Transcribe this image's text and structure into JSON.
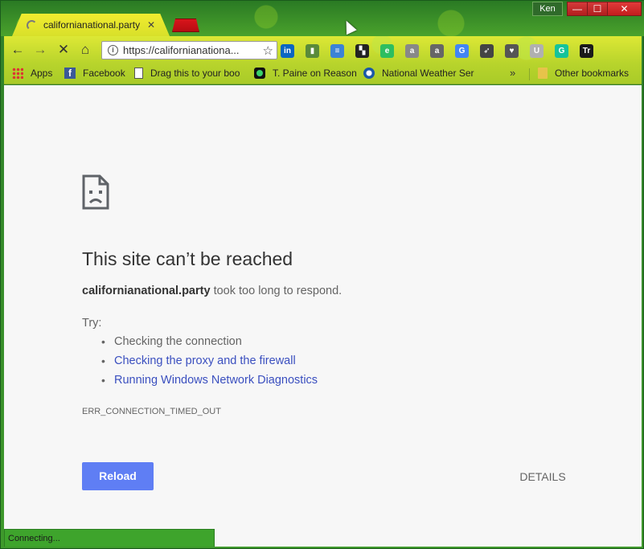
{
  "window": {
    "profile_name": "Ken",
    "minimize_glyph": "—",
    "maximize_glyph": "☐",
    "close_glyph": "✕"
  },
  "tab": {
    "title": "californianational.party",
    "close_glyph": "✕"
  },
  "toolbar": {
    "back_glyph": "←",
    "forward_glyph": "→",
    "stop_glyph": "✕",
    "home_glyph": "⌂",
    "url": "https://californianationa...",
    "star_glyph": "☆",
    "extensions": [
      {
        "name": "linkedin-icon",
        "glyph": "in",
        "color": "#0a66c2"
      },
      {
        "name": "bookmark-ext-icon",
        "glyph": "▮",
        "color": "#5a8a3a"
      },
      {
        "name": "drive-ext-icon",
        "glyph": "≡",
        "color": "#3b83d6"
      },
      {
        "name": "checker-ext-icon",
        "glyph": "▚",
        "color": "#222"
      },
      {
        "name": "evernote-icon",
        "glyph": "e",
        "color": "#2dbe60"
      },
      {
        "name": "amazon-icon",
        "glyph": "a",
        "color": "#888"
      },
      {
        "name": "amazon-assistant-icon",
        "glyph": "a",
        "color": "#666"
      },
      {
        "name": "google-translate-icon",
        "glyph": "G",
        "color": "#4285f4"
      },
      {
        "name": "rocket-icon",
        "glyph": "➶",
        "color": "#444"
      },
      {
        "name": "pocket-icon",
        "glyph": "♥",
        "color": "#555"
      },
      {
        "name": "ublock-icon",
        "glyph": "U",
        "color": "#b0b0b0"
      },
      {
        "name": "grammarly-icon",
        "glyph": "G",
        "color": "#15c39a"
      },
      {
        "name": "tr-icon",
        "glyph": "Tr",
        "color": "#1a1a1a"
      }
    ]
  },
  "bookmarks": {
    "items": [
      {
        "label": "Apps"
      },
      {
        "label": "Facebook"
      },
      {
        "label": "Drag this to your boo"
      },
      {
        "label": "T. Paine on Reason"
      },
      {
        "label": "National Weather Ser"
      }
    ],
    "overflow_glyph": "»",
    "other": "Other bookmarks"
  },
  "error": {
    "heading": "This site can’t be reached",
    "domain": "californianational.party",
    "summary_suffix": " took too long to respond.",
    "try_label": "Try:",
    "suggestions": [
      "Checking the connection",
      "Checking the proxy and the firewall",
      "Running Windows Network Diagnostics"
    ],
    "code": "ERR_CONNECTION_TIMED_OUT",
    "reload_label": "Reload",
    "details_label": "DETAILS"
  },
  "status": {
    "text": "Connecting..."
  }
}
